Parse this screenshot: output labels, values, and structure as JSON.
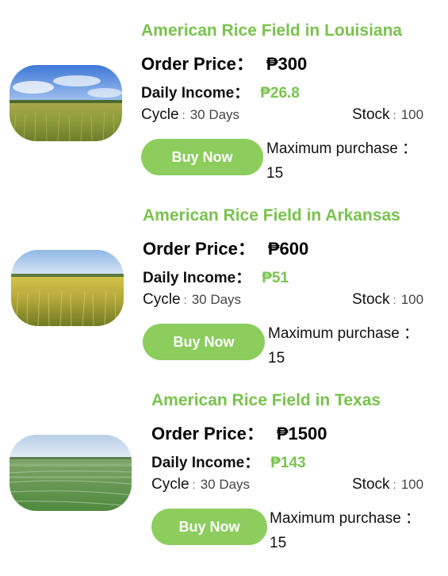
{
  "products": [
    {
      "title": "American Rice Field in Louisiana",
      "order_price_label": "Order Price：",
      "order_price": "₱300",
      "daily_income_label": "Daily Income：",
      "daily_income": "₱26.8",
      "cycle_label": "Cycle",
      "cycle_value": "30 Days",
      "stock_label": "Stock",
      "stock_value": "100",
      "buy_label": "Buy Now",
      "max_label": "Maximum purchase ：",
      "max_value": "15",
      "image_icon": "rice-field-photo"
    },
    {
      "title": "American Rice Field in Arkansas",
      "order_price_label": "Order Price：",
      "order_price": "₱600",
      "daily_income_label": "Daily Income：",
      "daily_income": "₱51",
      "cycle_label": "Cycle",
      "cycle_value": "30 Days",
      "stock_label": "Stock",
      "stock_value": "100",
      "buy_label": "Buy Now",
      "max_label": "Maximum purchase ：",
      "max_value": "15",
      "image_icon": "rice-field-photo"
    },
    {
      "title": "American Rice Field in Texas",
      "order_price_label": "Order Price：",
      "order_price": "₱1500",
      "daily_income_label": "Daily Income：",
      "daily_income": "₱143",
      "cycle_label": "Cycle",
      "cycle_value": "30 Days",
      "stock_label": "Stock",
      "stock_value": "100",
      "buy_label": "Buy Now",
      "max_label": "Maximum purchase ：",
      "max_value": "15",
      "image_icon": "flooded-rice-field-photo"
    }
  ],
  "colors": {
    "accent_green": "#7ac24e",
    "button_green": "#8ccd5e",
    "text": "#111111"
  }
}
